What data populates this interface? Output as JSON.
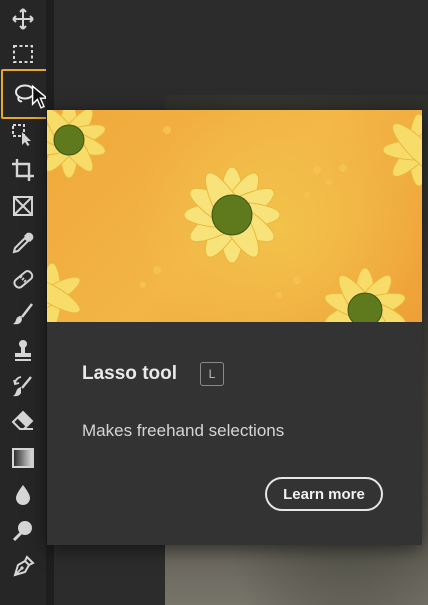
{
  "toolbar": {
    "tools": [
      {
        "name": "move-icon"
      },
      {
        "name": "rectangular-marquee-icon"
      },
      {
        "name": "lasso-icon",
        "selected": true
      },
      {
        "name": "object-selection-icon"
      },
      {
        "name": "crop-icon"
      },
      {
        "name": "frame-icon"
      },
      {
        "name": "eyedropper-icon"
      },
      {
        "name": "spot-healing-brush-icon"
      },
      {
        "name": "brush-icon"
      },
      {
        "name": "clone-stamp-icon"
      },
      {
        "name": "history-brush-icon"
      },
      {
        "name": "eraser-icon"
      },
      {
        "name": "gradient-icon"
      },
      {
        "name": "blur-icon"
      },
      {
        "name": "dodge-icon"
      },
      {
        "name": "pen-icon"
      }
    ],
    "selected_color": "#e8a82c"
  },
  "tooltip": {
    "title": "Lasso tool",
    "shortcut": "L",
    "description": "Makes freehand selections",
    "button_label": "Learn more",
    "preview_subject": "yellow daisies on orange background"
  }
}
